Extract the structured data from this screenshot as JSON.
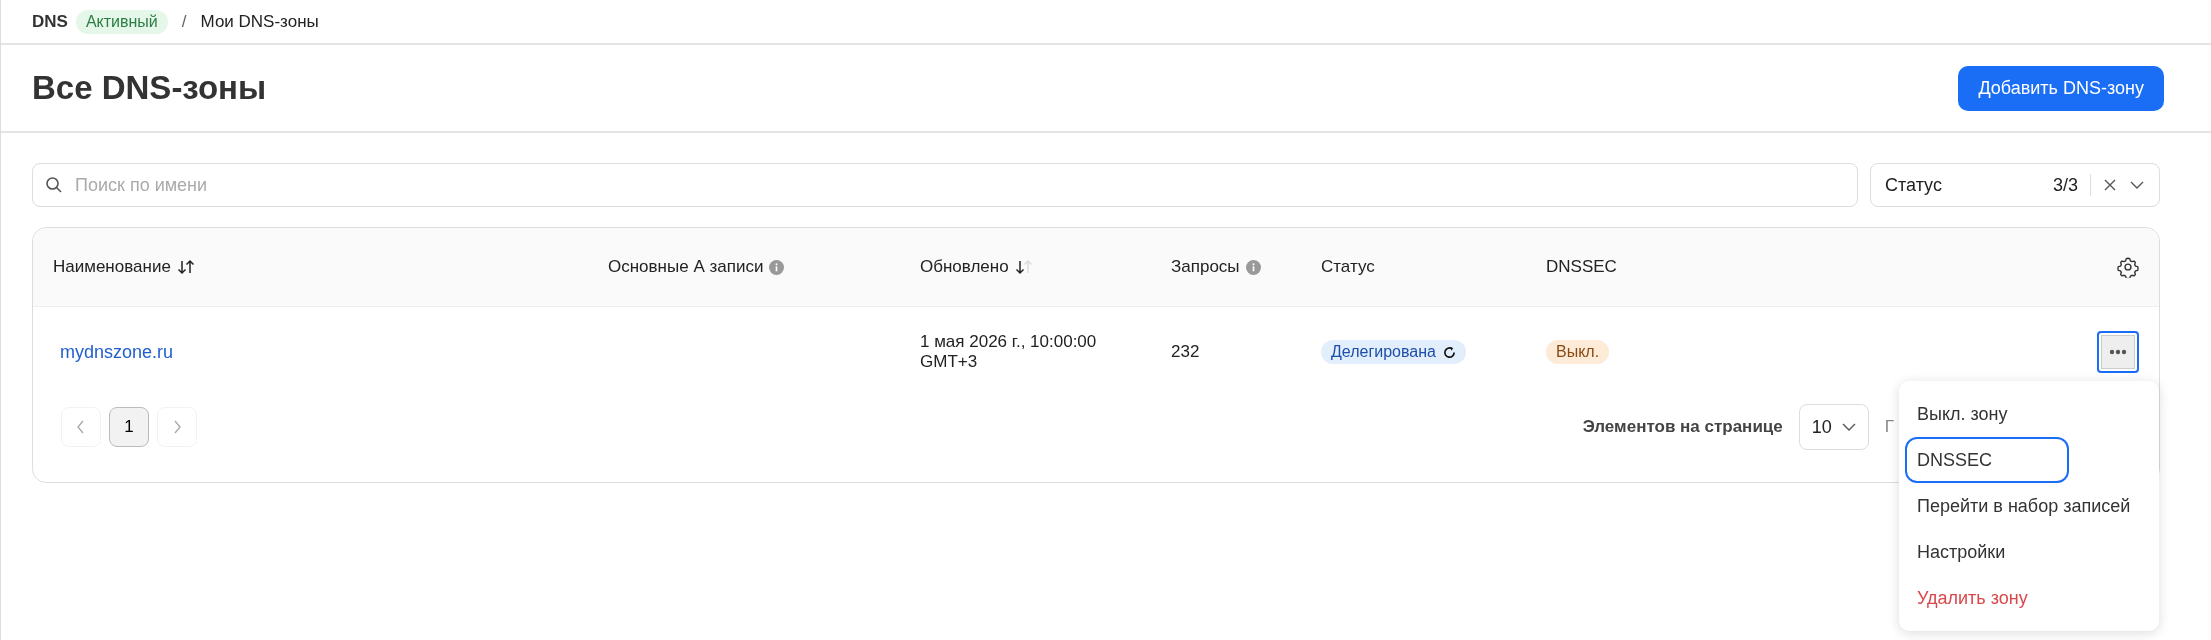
{
  "breadcrumb": {
    "service": "DNS",
    "service_status": "Активный",
    "separator": "/",
    "current": "Мои DNS-зоны"
  },
  "page": {
    "title": "Все DNS-зоны",
    "primary_button": "Добавить DNS-зону"
  },
  "search": {
    "placeholder": "Поиск по имени"
  },
  "status_filter": {
    "label": "Статус",
    "count": "3/3"
  },
  "table": {
    "columns": [
      {
        "label": "Наименование",
        "kind": "sort-both"
      },
      {
        "label": "Основные А записи",
        "kind": "info"
      },
      {
        "label": "Обновлено",
        "kind": "sort-desc"
      },
      {
        "label": "Запросы",
        "kind": "info"
      },
      {
        "label": "Статус",
        "kind": "plain"
      },
      {
        "label": "DNSSEC",
        "kind": "plain"
      }
    ],
    "rows": [
      {
        "name": "mydnszone.ru",
        "updated": [
          "1 мая 2026 г., 10:00:00",
          "GMT+3"
        ],
        "requests": "232",
        "status": {
          "label": "Делегирована",
          "kind": "pending"
        },
        "dnssec": {
          "label": "Выкл.",
          "kind": "off"
        },
        "menu_open": true
      }
    ]
  },
  "pagination": {
    "pages": [
      {
        "label": "1",
        "selected": true
      }
    ],
    "page_size_label": "Элементов на странице",
    "page_size": "10",
    "trailing_text": "Г"
  },
  "row_menu": {
    "items": [
      {
        "label": "Выкл. зону",
        "kind": "normal",
        "selected": false
      },
      {
        "label": "DNSSEC",
        "kind": "normal",
        "selected": true
      },
      {
        "label": "Перейти в набор записей",
        "kind": "normal",
        "selected": false
      },
      {
        "label": "Настройки",
        "kind": "normal",
        "selected": false
      },
      {
        "label": "Удалить зону",
        "kind": "danger",
        "selected": false
      }
    ]
  }
}
